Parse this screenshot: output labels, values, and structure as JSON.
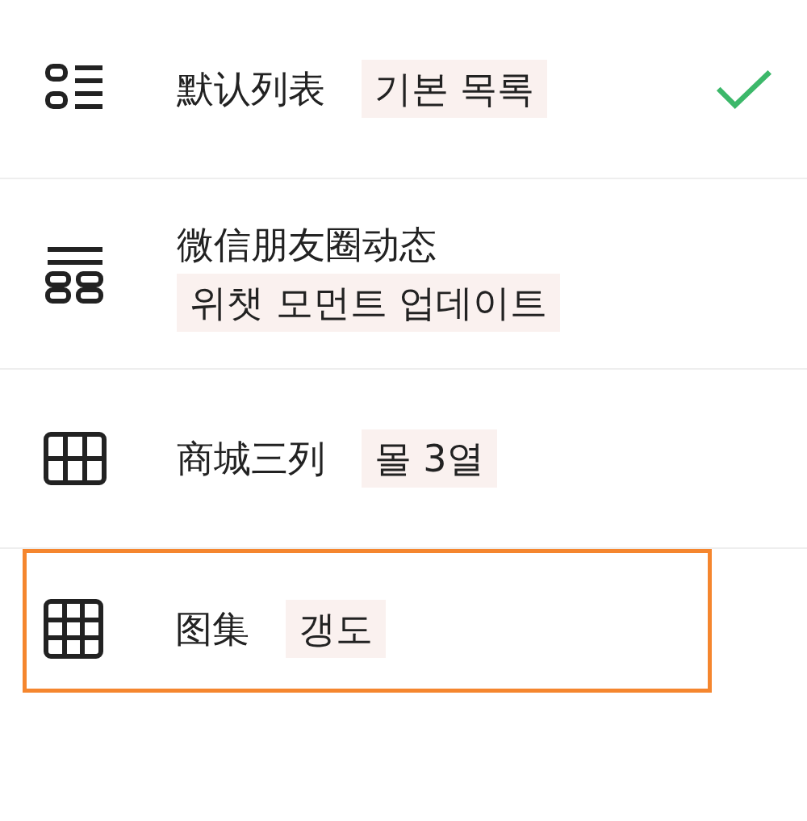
{
  "items": [
    {
      "kind": "list-bullets",
      "label": "默认列表",
      "translation": "기본 목록",
      "selected": true,
      "highlighted": false
    },
    {
      "kind": "list-stacked",
      "label": "微信朋友圈动态",
      "translation": "위챗 모먼트 업데이트",
      "selected": false,
      "highlighted": false
    },
    {
      "kind": "grid-3x2",
      "label": "商城三列",
      "translation": "몰 3열",
      "selected": false,
      "highlighted": false
    },
    {
      "kind": "grid-3x3",
      "label": "图集",
      "translation": "갱도",
      "selected": false,
      "highlighted": true
    }
  ]
}
